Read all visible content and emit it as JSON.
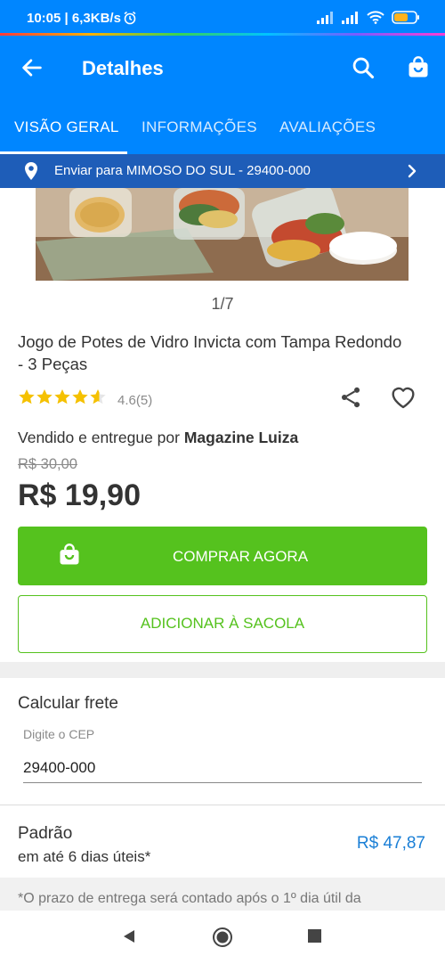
{
  "status_bar": {
    "time": "10:05 | 6,3KB/s",
    "alarm_icon": "alarm-icon",
    "signal_icon": "signal-icon",
    "wifi_icon": "wifi-icon",
    "battery_icon": "battery-icon"
  },
  "app_bar": {
    "title": "Detalhes",
    "back_icon": "arrow-left-icon",
    "search_icon": "search-icon",
    "bag_icon": "shopping-bag-icon"
  },
  "tabs": [
    {
      "label": "VISÃO GERAL",
      "active": true
    },
    {
      "label": "INFORMAÇÕES",
      "active": false
    },
    {
      "label": "AVALIAÇÕES",
      "active": false
    }
  ],
  "shipping_banner": {
    "text": "Enviar para MIMOSO DO SUL - 29400-000",
    "icon": "location-pin-icon"
  },
  "gallery": {
    "pager": "1/7"
  },
  "product": {
    "title": "Jogo de Potes de Vidro Invicta com Tampa Redondo - 3 Peças",
    "rating_value": 4.6,
    "rating_text": "4.6(5)",
    "seller_prefix": "Vendido e entregue por",
    "seller_name": "Magazine Luiza",
    "old_price": "R$ 30,00",
    "price": "R$ 19,90"
  },
  "actions": {
    "buy_now": "COMPRAR AGORA",
    "add_to_bag": "ADICIONAR À SACOLA"
  },
  "frete": {
    "title": "Calcular frete",
    "cep_label": "Digite o CEP",
    "cep_value": "29400-000",
    "option_name": "Padrão",
    "option_days": "em até 6 dias úteis*",
    "option_price": "R$ 47,87",
    "note": "*O prazo de entrega será contado após o 1º dia útil da"
  },
  "colors": {
    "primary": "#0086ff",
    "banner": "#1e5db8",
    "buy_green": "#55c21e",
    "price_blue": "#1a7fd6",
    "star": "#f5c100"
  }
}
